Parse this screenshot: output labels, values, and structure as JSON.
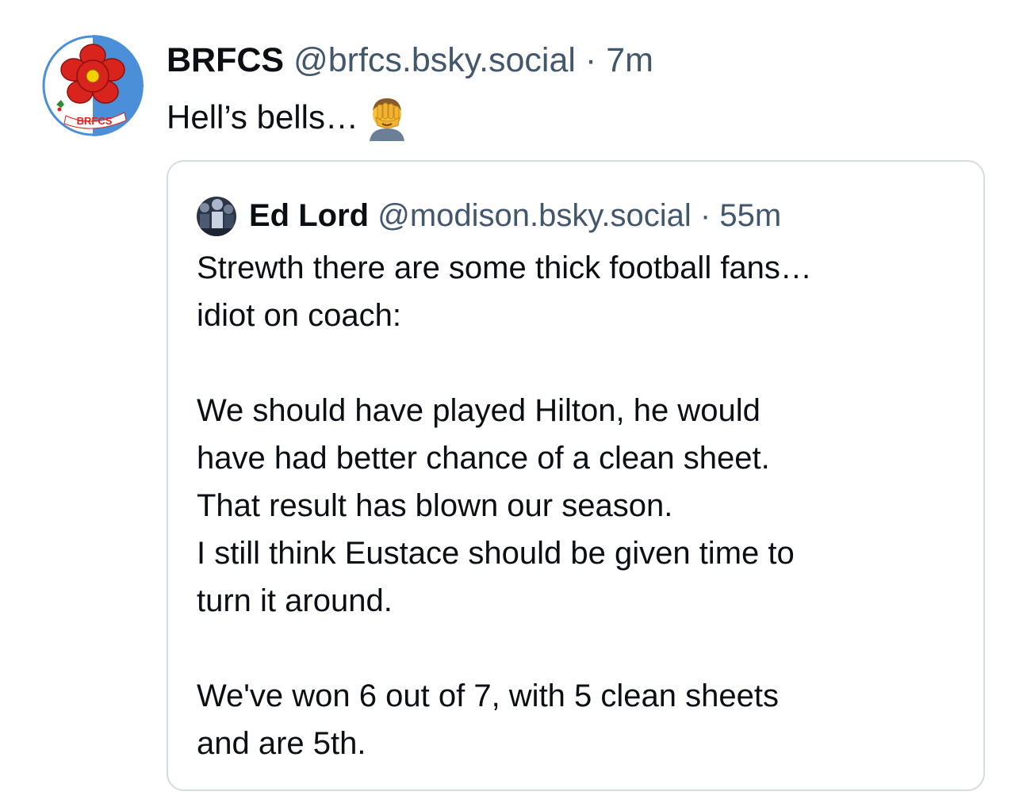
{
  "post": {
    "author": {
      "display_name": "BRFCS",
      "handle": "@brfcs.bsky.social",
      "avatar_icon": "rose-crest-icon",
      "avatar_text": "BRFCS"
    },
    "separator": "·",
    "time": "7m",
    "text": "Hell’s bells…",
    "emoji_icon": "facepalm-emoji-icon"
  },
  "quote": {
    "author": {
      "display_name": "Ed Lord",
      "handle": "@modison.bsky.social",
      "avatar_icon": "crowd-photo-avatar-icon"
    },
    "separator": "·",
    "time": "55m",
    "lines": [
      "Strewth there are some thick football fans…",
      "idiot on coach:",
      "",
      "We should have played Hilton, he would",
      "have had better chance of a clean sheet.",
      "That result has blown our season.",
      "I still think Eustace should be given time to",
      "turn it around.",
      "",
      "We've won 6 out of 7, with 5 clean sheets",
      "and are 5th."
    ]
  },
  "colors": {
    "text_primary": "#0b0f14",
    "text_secondary": "#42576c",
    "border": "#d4dbe2",
    "crest_blue": "#4a8fd8",
    "crest_red": "#d9241e"
  }
}
